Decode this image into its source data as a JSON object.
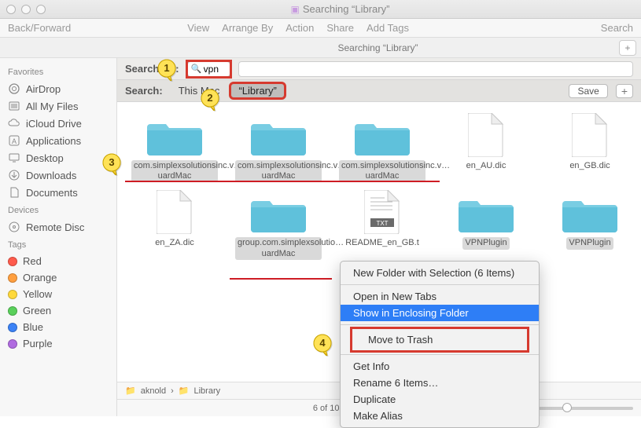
{
  "window": {
    "title": "Searching “Library”"
  },
  "toolbar": {
    "back_forward": "Back/Forward",
    "menu": [
      "View",
      "Arrange By",
      "Action",
      "Share",
      "Add Tags"
    ],
    "search_label": "Search"
  },
  "scopebar": {
    "label": "Searching “Library”",
    "plus": "+"
  },
  "sidebar": {
    "favorites_header": "Favorites",
    "favorites": [
      {
        "icon": "airdrop",
        "label": "AirDrop"
      },
      {
        "icon": "allfiles",
        "label": "All My Files"
      },
      {
        "icon": "icloud",
        "label": "iCloud Drive"
      },
      {
        "icon": "applications",
        "label": "Applications"
      },
      {
        "icon": "desktop",
        "label": "Desktop"
      },
      {
        "icon": "downloads",
        "label": "Downloads"
      },
      {
        "icon": "documents",
        "label": "Documents"
      }
    ],
    "devices_header": "Devices",
    "devices": [
      {
        "icon": "disc",
        "label": "Remote Disc"
      }
    ],
    "tags_header": "Tags",
    "tags": [
      {
        "color": "#ff5b4c",
        "label": "Red"
      },
      {
        "color": "#ff9f3f",
        "label": "Orange"
      },
      {
        "color": "#ffd93b",
        "label": "Yellow"
      },
      {
        "color": "#59d05a",
        "label": "Green"
      },
      {
        "color": "#3b82f6",
        "label": "Blue"
      },
      {
        "color": "#b06be0",
        "label": "Purple"
      }
    ]
  },
  "search": {
    "label": "Search for:",
    "value": "vpn",
    "row2_label": "Search:",
    "scopes": [
      "This Mac",
      "“Library”"
    ],
    "active_scope_index": 1,
    "save": "Save",
    "plus": "+"
  },
  "items": {
    "row1": [
      {
        "type": "folder",
        "name": "com.simplexsolutionsinc.v…uardMac",
        "selected": true
      },
      {
        "type": "folder",
        "name": "com.simplexsolutionsinc.v…uardMac",
        "selected": true
      },
      {
        "type": "folder",
        "name": "com.simplexsolutionsinc.v…uardMac",
        "selected": true
      },
      {
        "type": "file",
        "name": "en_AU.dic",
        "selected": false
      },
      {
        "type": "file",
        "name": "en_GB.dic",
        "selected": false
      }
    ],
    "row2": [
      {
        "type": "file",
        "name": "en_ZA.dic",
        "selected": false
      },
      {
        "type": "folder",
        "name": "group.com.simplexsolutio…uardMac",
        "selected": true
      },
      {
        "type": "txt",
        "name": "README_en_GB.t",
        "selected": false
      },
      {
        "type": "folder",
        "name": "VPNPlugin",
        "selected": true
      },
      {
        "type": "folder",
        "name": "VPNPlugin",
        "selected": true
      }
    ]
  },
  "context_menu": {
    "items": [
      "New Folder with Selection (6 Items)",
      "---",
      "Open in New Tabs",
      "Show in Enclosing Folder",
      "---",
      "Move to Trash",
      "---",
      "Get Info",
      "Rename 6 Items…",
      "Duplicate",
      "Make Alias"
    ],
    "highlighted_index": 3,
    "red_box_index": 5
  },
  "pathbar": {
    "segments": [
      "aknold",
      "Library"
    ]
  },
  "statusbar": {
    "text": "6 of 10 se"
  },
  "markers": [
    "1",
    "2",
    "3",
    "4"
  ]
}
